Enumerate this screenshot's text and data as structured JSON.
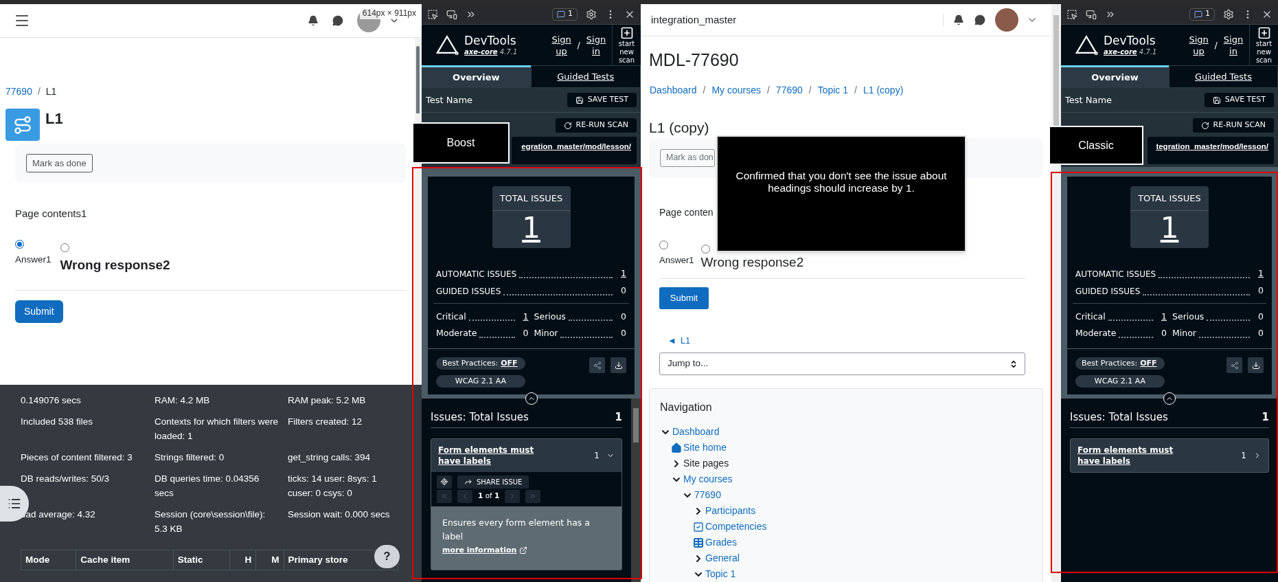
{
  "left_page": {
    "size_readout": "614px × 911px",
    "breadcrumb": [
      {
        "label": "77690",
        "link": true
      },
      {
        "label": "L1",
        "link": false
      }
    ],
    "breadcrumb_separator": "/",
    "title": "L1",
    "mark_done": "Mark as done",
    "content": "Page contents1",
    "answers": [
      {
        "label": "Answer1",
        "selected": true,
        "kind": "plain"
      },
      {
        "label": "Wrong response2",
        "selected": false,
        "kind": "bold"
      }
    ],
    "submit": "Submit",
    "stats": [
      "0.149076 secs",
      "RAM: 4.2 MB",
      "RAM peak: 5.2 MB",
      "Included 538 files",
      "Contexts for which filters were loaded: 1",
      "Filters created: 12",
      "Pieces of content filtered: 3",
      "Strings filtered: 0",
      "get_string calls: 394",
      "DB reads/writes: 50/3",
      "DB queries time: 0.04356 secs",
      "ticks: 14 user: 8sys: 1 cuser: 0 csys: 0",
      "oad average: 4.32",
      "Session (core\\session\\file): 5.3 KB",
      "Session wait: 0.000 secs"
    ],
    "help": "?",
    "table": {
      "columns": [
        "Mode",
        "Cache item",
        "Static",
        "H",
        "M",
        "Primary store"
      ]
    }
  },
  "devtools": [
    {
      "annotation": "Boost",
      "badge": "1",
      "brand": "DevTools",
      "engine": "axe-core",
      "version": "4.7.1",
      "sign_up": "Sign up",
      "separator": "/",
      "sign_in": "Sign in",
      "new_scan": "start new scan",
      "tabs": [
        {
          "label": "Overview",
          "selected": true
        },
        {
          "label": "Guided Tests",
          "selected": false
        }
      ],
      "test_name": "Test Name",
      "save": "SAVE TEST",
      "rerun": "RE-RUN SCAN",
      "url": "egration_master/mod/lesson/",
      "total_label": "TOTAL ISSUES",
      "total": "1",
      "counts": [
        {
          "label": "AUTOMATIC ISSUES",
          "value": "1",
          "link": true
        },
        {
          "label": "GUIDED ISSUES",
          "value": "0",
          "link": false
        }
      ],
      "severity": [
        {
          "label": "Critical",
          "value": "1",
          "link": true
        },
        {
          "label": "Serious",
          "value": "0",
          "link": false
        },
        {
          "label": "Moderate",
          "value": "0",
          "link": false
        },
        {
          "label": "Minor",
          "value": "0",
          "link": false
        }
      ],
      "best_practices_label": "Best Practices:",
      "best_practices": "OFF",
      "standard": "WCAG 2.1 AA",
      "issues_title": "Issues: Total Issues",
      "issues_count": "1",
      "issues": [
        {
          "title": "Form elements must have labels",
          "count": "1",
          "expanded": true,
          "share": "SHARE ISSUE",
          "pager": "**1** of **1**",
          "description": "Ensures every form element has a label",
          "more": "more information"
        }
      ]
    },
    {
      "annotation": "Classic",
      "badge": "1",
      "brand": "DevTools",
      "engine": "axe-core",
      "version": "4.7.1",
      "sign_up": "Sign up",
      "separator": "/",
      "sign_in": "Sign in",
      "new_scan": "start new scan",
      "tabs": [
        {
          "label": "Overview",
          "selected": true
        },
        {
          "label": "Guided Tests",
          "selected": false
        }
      ],
      "test_name": "Test Name",
      "save": "SAVE TEST",
      "rerun": "RE-RUN SCAN",
      "url": "tegration_master/mod/lesson/",
      "total_label": "TOTAL ISSUES",
      "total": "1",
      "counts": [
        {
          "label": "AUTOMATIC ISSUES",
          "value": "1",
          "link": true
        },
        {
          "label": "GUIDED ISSUES",
          "value": "0",
          "link": false
        }
      ],
      "severity": [
        {
          "label": "Critical",
          "value": "1",
          "link": true
        },
        {
          "label": "Serious",
          "value": "0",
          "link": false
        },
        {
          "label": "Moderate",
          "value": "0",
          "link": false
        },
        {
          "label": "Minor",
          "value": "0",
          "link": false
        }
      ],
      "best_practices_label": "Best Practices:",
      "best_practices": "OFF",
      "standard": "WCAG 2.1 AA",
      "issues_title": "Issues: Total Issues",
      "issues_count": "1",
      "issues": [
        {
          "title": "Form elements must have labels",
          "count": "1",
          "expanded": false
        }
      ]
    }
  ],
  "middle_page": {
    "site": "integration_master",
    "title": "MDL-77690",
    "breadcrumb": [
      {
        "label": "Dashboard",
        "link": true
      },
      {
        "label": "My courses",
        "link": true
      },
      {
        "label": "77690",
        "link": true
      },
      {
        "label": "Topic 1",
        "link": true
      },
      {
        "label": "L1 (copy)",
        "link": true
      }
    ],
    "breadcrumb_separator": "/",
    "activity": "L1 (copy)",
    "mark_done": "Mark as don",
    "content": "Page conten",
    "answers": [
      {
        "label": "Answer1",
        "selected": false,
        "kind": "plain"
      },
      {
        "label": "Wrong response2",
        "selected": false,
        "kind": "large"
      }
    ],
    "submit": "Submit",
    "prev_arrow": "◄",
    "prev": "L1",
    "jump": "Jump to...",
    "nav_title": "Navigation",
    "tree": [
      {
        "label": "Dashboard",
        "link": true,
        "kind": "branch",
        "expanded": true,
        "children": [
          {
            "label": "Site home",
            "link": true,
            "kind": "home"
          },
          {
            "label": "Site pages",
            "link": false,
            "kind": "branch",
            "expanded": false
          },
          {
            "label": "My courses",
            "link": true,
            "kind": "branch",
            "expanded": true,
            "children": [
              {
                "label": "77690",
                "link": true,
                "kind": "branch",
                "expanded": true,
                "children": [
                  {
                    "label": "Participants",
                    "link": true,
                    "kind": "branch",
                    "expanded": false
                  },
                  {
                    "label": "Competencies",
                    "link": true,
                    "kind": "competency"
                  },
                  {
                    "label": "Grades",
                    "link": true,
                    "kind": "grades"
                  },
                  {
                    "label": "General",
                    "link": true,
                    "kind": "branch",
                    "expanded": false
                  },
                  {
                    "label": "Topic 1",
                    "link": true,
                    "kind": "branch",
                    "expanded": true
                  }
                ]
              }
            ]
          }
        ]
      }
    ],
    "note": "Confirmed that you don't see the issue about headings should increase by 1."
  }
}
